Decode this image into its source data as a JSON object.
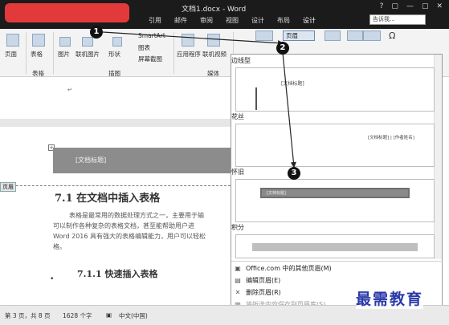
{
  "titlebar": {
    "doc_title": "文档1.docx - Word",
    "tabs": [
      "引用",
      "邮件",
      "审阅",
      "视图",
      "设计",
      "布局",
      "设计"
    ],
    "tell_me": "告诉我...",
    "icons": [
      "?",
      "▢",
      "—",
      "▢",
      "✕"
    ]
  },
  "ribbon": {
    "page_btn": "页面",
    "table_btn": "表格",
    "table_group": "表格",
    "picture_btn": "图片",
    "online_picture_btn": "联机图片",
    "shapes_btn": "形状",
    "smartart_btn": "SmartArt",
    "chart_btn": "图表",
    "screenshot_btn": "屏幕截图",
    "illustrations_group": "插图",
    "apps_btn": "应用程序",
    "online_video_btn": "联机视频",
    "media_group": "媒体",
    "header_btn": "页眉",
    "omega": "Ω"
  },
  "document": {
    "header_placeholder": "[文档标题]",
    "page_label": "页眉",
    "heading1": "7.1 在文档中插入表格",
    "para_lines": [
      "表格是最常用的数据处理方式之一，主要用于输",
      "可以制作各种复杂的表格文档，甚至能帮助用户进",
      "Word 2016 具有强大的表格编辑能力，用户可以轻松",
      "格。"
    ],
    "heading2": "7.1.1 快速插入表格"
  },
  "panel": {
    "sections": [
      {
        "label": "边线型",
        "preview_text": "[文档标题]"
      },
      {
        "label": "花丝",
        "preview_text": "[文档标题] | [作者姓名]"
      },
      {
        "label": "怀旧",
        "preview_text": "[文档标题]"
      },
      {
        "label": "积分",
        "preview_text": ""
      }
    ],
    "menu": [
      {
        "label": "Office.com 中的其他页眉(M)",
        "icon": "▣"
      },
      {
        "label": "编辑页眉(E)",
        "icon": "▤"
      },
      {
        "label": "删除页眉(R)",
        "icon": "✕"
      },
      {
        "label": "将所选内容保存到页眉库(S)...",
        "icon": "▥"
      }
    ]
  },
  "statusbar": {
    "page": "第 3 页，共 8 页",
    "words": "1628 个字",
    "lang": "中文(中国)"
  },
  "watermark": "最需教育",
  "badges": [
    "1",
    "2",
    "3"
  ]
}
